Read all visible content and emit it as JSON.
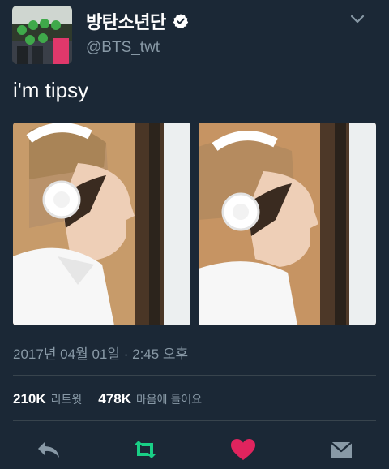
{
  "author": {
    "name": "방탄소년단",
    "handle": "@BTS_twt"
  },
  "tweet": {
    "text": "i'm tipsy",
    "timestamp": "2017년 04월 01일 · 2:45 오후"
  },
  "stats": {
    "retweets_count": "210K",
    "retweets_label": "리트윗",
    "likes_count": "478K",
    "likes_label": "마음에 들어요"
  },
  "icons": {
    "verified": "verified-badge-icon",
    "more": "chevron-down-icon",
    "reply": "reply-icon",
    "retweet": "retweet-icon",
    "like": "heart-icon",
    "dm": "direct-message-icon"
  },
  "colors": {
    "background": "#1b2836",
    "muted": "#8899a6",
    "retweet_active": "#19cf86",
    "like_active": "#e0245e"
  }
}
